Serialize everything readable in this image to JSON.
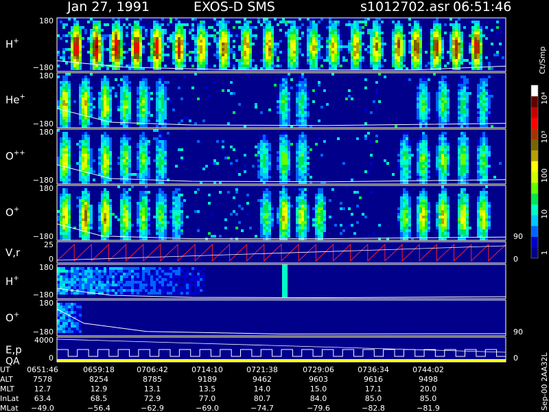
{
  "header": {
    "date": "Jan 27, 1991",
    "instrument": "EXOS-D SMS",
    "file": "s1012702.asr",
    "time": "06:51:46"
  },
  "colorbar": {
    "unit": "Ct/Smp",
    "ticks": [
      {
        "label": "1",
        "value": 1
      },
      {
        "label": "10",
        "value": 10
      },
      {
        "label": "100",
        "value": 100
      },
      {
        "label": "10³",
        "value": 1000
      },
      {
        "label": "10⁴",
        "value": 10000
      }
    ],
    "colors": [
      "#00008b",
      "#0000cd",
      "#0064ff",
      "#00c8ff",
      "#00ffc8",
      "#00e650",
      "#64ff00",
      "#d2ff00",
      "#ffff00",
      "#b4a000",
      "#786400",
      "#aa3200",
      "#ff0000",
      "#c80000",
      "#640000",
      "#ffffff"
    ]
  },
  "chart_data": [
    {
      "type": "heatmap",
      "name": "H+",
      "label_main": "H",
      "label_sup": "+",
      "ylim": [
        -180,
        180
      ],
      "yticks": [
        "180",
        "−180"
      ],
      "background": 0.3,
      "events": [
        [
          0.04,
          0.82
        ],
        [
          0.085,
          0.85
        ],
        [
          0.13,
          0.83
        ],
        [
          0.175,
          0.8
        ],
        [
          0.22,
          0.78
        ],
        [
          0.27,
          0.72
        ],
        [
          0.32,
          0.6
        ],
        [
          0.37,
          0.65
        ],
        [
          0.42,
          0.62
        ],
        [
          0.47,
          0.6
        ],
        [
          0.525,
          0.55
        ],
        [
          0.57,
          0.52
        ],
        [
          0.615,
          0.55
        ],
        [
          0.665,
          0.6
        ],
        [
          0.71,
          0.62
        ],
        [
          0.76,
          0.65
        ],
        [
          0.8,
          0.7
        ],
        [
          0.845,
          0.72
        ],
        [
          0.89,
          0.74
        ],
        [
          0.935,
          0.76
        ]
      ],
      "curve": [
        [
          0.0,
          0.2
        ],
        [
          0.15,
          0.08
        ],
        [
          0.4,
          0.03
        ],
        [
          0.8,
          0.03
        ],
        [
          1.0,
          0.1
        ]
      ]
    },
    {
      "type": "heatmap",
      "name": "He+",
      "label_main": "He",
      "label_sup": "+",
      "ylim": [
        -180,
        180
      ],
      "yticks": [
        "180",
        "−180"
      ],
      "background": 0.05,
      "events": [
        [
          0.015,
          0.55
        ],
        [
          0.06,
          0.52
        ],
        [
          0.105,
          0.5
        ],
        [
          0.15,
          0.42
        ],
        [
          0.19,
          0.38
        ],
        [
          0.23,
          0.3
        ],
        [
          0.505,
          0.3
        ],
        [
          0.545,
          0.28
        ],
        [
          0.815,
          0.32
        ],
        [
          0.86,
          0.34
        ],
        [
          0.905,
          0.32
        ],
        [
          0.95,
          0.3
        ]
      ],
      "curve": [
        [
          0.0,
          0.35
        ],
        [
          0.12,
          0.1
        ],
        [
          0.3,
          0.05
        ],
        [
          0.6,
          0.04
        ],
        [
          1.0,
          0.08
        ]
      ]
    },
    {
      "type": "heatmap",
      "name": "O++",
      "label_main": "O",
      "label_sup": "++",
      "ylim": [
        -180,
        180
      ],
      "yticks": [
        "180",
        "−180"
      ],
      "background": 0.05,
      "events": [
        [
          0.015,
          0.52
        ],
        [
          0.06,
          0.5
        ],
        [
          0.105,
          0.48
        ],
        [
          0.15,
          0.4
        ],
        [
          0.19,
          0.36
        ],
        [
          0.23,
          0.3
        ],
        [
          0.46,
          0.3
        ],
        [
          0.505,
          0.4
        ],
        [
          0.545,
          0.34
        ],
        [
          0.775,
          0.32
        ],
        [
          0.815,
          0.38
        ],
        [
          0.86,
          0.42
        ],
        [
          0.905,
          0.4
        ],
        [
          0.95,
          0.35
        ]
      ],
      "curve": [
        [
          0.0,
          0.35
        ],
        [
          0.12,
          0.1
        ],
        [
          0.3,
          0.05
        ],
        [
          0.6,
          0.04
        ],
        [
          1.0,
          0.08
        ]
      ]
    },
    {
      "type": "heatmap",
      "name": "O+",
      "label_main": "O",
      "label_sup": "+",
      "ylim": [
        -180,
        180
      ],
      "yticks": [
        "180",
        "−180"
      ],
      "background": 0.08,
      "events": [
        [
          0.015,
          0.55
        ],
        [
          0.06,
          0.62
        ],
        [
          0.105,
          0.58
        ],
        [
          0.15,
          0.48
        ],
        [
          0.19,
          0.4
        ],
        [
          0.23,
          0.35
        ],
        [
          0.265,
          0.28
        ],
        [
          0.465,
          0.38
        ],
        [
          0.505,
          0.55
        ],
        [
          0.545,
          0.48
        ],
        [
          0.585,
          0.38
        ],
        [
          0.775,
          0.42
        ],
        [
          0.815,
          0.5
        ],
        [
          0.86,
          0.55
        ],
        [
          0.905,
          0.52
        ],
        [
          0.95,
          0.48
        ]
      ],
      "curve": [
        [
          0.0,
          0.3
        ],
        [
          0.1,
          0.08
        ],
        [
          0.3,
          0.03
        ],
        [
          0.6,
          0.03
        ],
        [
          1.0,
          0.06
        ]
      ],
      "right_label": "90"
    },
    {
      "type": "line",
      "name": "V,r",
      "label_main": "V,r",
      "ylim": [
        0,
        25
      ],
      "yticks": [
        "25",
        "0"
      ],
      "right_label": "0",
      "sawtooth_periods": 26
    },
    {
      "type": "heatmap",
      "name": "H+ (lower)",
      "label_main": "H",
      "label_sup": "+",
      "ylim": [
        -180,
        180
      ],
      "yticks": [
        "180",
        "−180"
      ],
      "background": 0.0,
      "patch": [
        0.0,
        0.33
      ],
      "spike": 0.505,
      "curve": [
        [
          0.0,
          0.3
        ],
        [
          0.12,
          0.1
        ],
        [
          0.3,
          0.04
        ],
        [
          0.6,
          0.03
        ],
        [
          1.0,
          0.06
        ]
      ]
    },
    {
      "type": "heatmap",
      "name": "O+ (lower)",
      "label_main": "O",
      "label_sup": "+",
      "ylim": [
        -180,
        180
      ],
      "yticks": [
        "180",
        "−180"
      ],
      "background": 0.0,
      "patch": [
        0.0,
        0.05
      ],
      "curve": [
        [
          0.0,
          0.75
        ],
        [
          0.06,
          0.35
        ],
        [
          0.2,
          0.12
        ],
        [
          0.5,
          0.05
        ],
        [
          1.0,
          0.06
        ]
      ],
      "right_label": "90"
    },
    {
      "type": "line",
      "name": "E,p QA",
      "label_main": "E,p",
      "label_sub": "QA",
      "ylim": [
        0,
        4000
      ],
      "yticks": [
        "4000",
        "0"
      ],
      "right_label": "0",
      "step_periods": 22
    }
  ],
  "ephemeris": {
    "rows": [
      {
        "label": "UT",
        "values": [
          "0651:46",
          "0659:18",
          "0706:42",
          "0714:10",
          "0721:38",
          "0729:06",
          "0736:34",
          "0744:02"
        ]
      },
      {
        "label": "ALT",
        "values": [
          "7578",
          "8254",
          "8785",
          "9189",
          "9462",
          "9603",
          "9616",
          "9498"
        ]
      },
      {
        "label": "MLT",
        "values": [
          "12.7",
          "12.9",
          "13.1",
          "13.5",
          "14.0",
          "15.0",
          "17.1",
          "20.0"
        ]
      },
      {
        "label": "InLat",
        "values": [
          "63.4",
          "68.5",
          "72.9",
          "77.0",
          "80.7",
          "84.0",
          "85.0",
          "85.0"
        ]
      },
      {
        "label": "MLat",
        "values": [
          "−49.0",
          "−56.4",
          "−62.9",
          "−69.0",
          "−74.7",
          "−79.6",
          "−82.8",
          "−81.9"
        ]
      }
    ]
  },
  "footer_stamp": "Sep-00 2AA32L"
}
